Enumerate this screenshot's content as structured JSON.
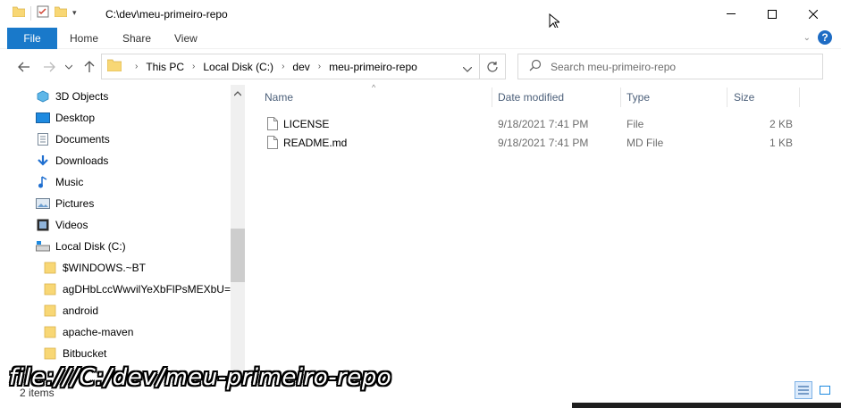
{
  "titlebar": {
    "title": "C:\\dev\\meu-primeiro-repo"
  },
  "ribbon": {
    "file": "File",
    "home": "Home",
    "share": "Share",
    "view": "View",
    "help": "?"
  },
  "address": {
    "crumbs": [
      "This PC",
      "Local Disk (C:)",
      "dev",
      "meu-primeiro-repo"
    ]
  },
  "search": {
    "placeholder": "Search meu-primeiro-repo"
  },
  "nav": {
    "items": [
      {
        "label": "3D Objects",
        "icon": "3d-objects-icon"
      },
      {
        "label": "Desktop",
        "icon": "desktop-icon"
      },
      {
        "label": "Documents",
        "icon": "documents-icon"
      },
      {
        "label": "Downloads",
        "icon": "downloads-icon"
      },
      {
        "label": "Music",
        "icon": "music-icon"
      },
      {
        "label": "Pictures",
        "icon": "pictures-icon"
      },
      {
        "label": "Videos",
        "icon": "videos-icon"
      },
      {
        "label": "Local Disk (C:)",
        "icon": "drive-icon"
      },
      {
        "label": "$WINDOWS.~BT",
        "icon": "folder-icon"
      },
      {
        "label": "agDHbLccWwvilYeXbFlPsMEXbU=",
        "icon": "folder-icon"
      },
      {
        "label": "android",
        "icon": "folder-icon"
      },
      {
        "label": "apache-maven",
        "icon": "folder-icon"
      },
      {
        "label": "Bitbucket",
        "icon": "folder-icon"
      }
    ]
  },
  "columns": {
    "name": "Name",
    "date": "Date modified",
    "type": "Type",
    "size": "Size"
  },
  "files": [
    {
      "name": "LICENSE",
      "date": "9/18/2021 7:41 PM",
      "type": "File",
      "size": "2 KB"
    },
    {
      "name": "README.md",
      "date": "9/18/2021 7:41 PM",
      "type": "MD File",
      "size": "1 KB"
    }
  ],
  "status": {
    "items": "2 items"
  },
  "overlay": {
    "path": "file:///C:/dev/meu-primeiro-repo"
  },
  "colors": {
    "accent": "#1979ca",
    "folder": "#f8d775",
    "header_text": "#4c607a"
  }
}
